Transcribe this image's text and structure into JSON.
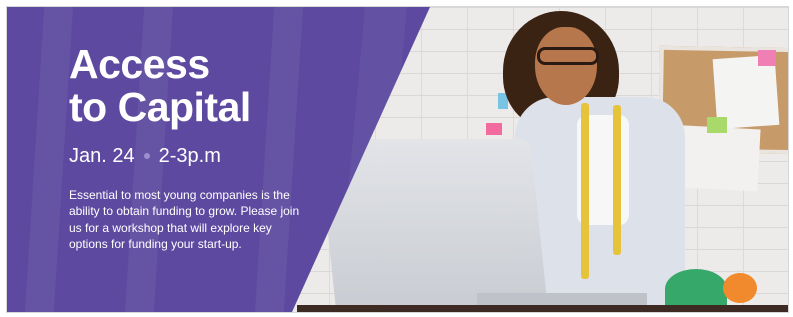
{
  "banner": {
    "headline_line1": "Access",
    "headline_line2": "to Capital",
    "date": "Jan. 24",
    "time": "2-3p.m",
    "description": "Essential to most young companies is the ability to obtain funding to grow. Please join us for a workshop that will explore key options for funding your start-up."
  },
  "colors": {
    "panel": "#5d4aa0",
    "text": "#ffffff",
    "bullet": "#9b8fd0"
  }
}
